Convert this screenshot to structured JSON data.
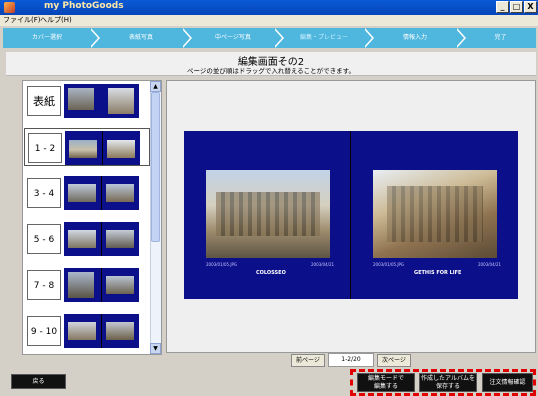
{
  "window": {
    "title": "my  PhotoGoods",
    "controls": [
      "_",
      "□",
      "X"
    ]
  },
  "menu": [
    "ファイル(F)",
    "ヘルプ(H)"
  ],
  "steps": [
    "カバー選択",
    "表紙写真",
    "中ページ写真",
    "編集・プレビュー",
    "情報入力",
    "完了"
  ],
  "active_step": 3,
  "header": {
    "title": "編集画面その2",
    "subtitle": "ページの並び順はドラッグで入れ替えることができます。"
  },
  "thumbnails": [
    {
      "label": "表紙"
    },
    {
      "label": "1 - 2"
    },
    {
      "label": "3 - 4"
    },
    {
      "label": "5 - 6"
    },
    {
      "label": "7 - 8"
    },
    {
      "label": "9 - 10"
    }
  ],
  "selected_index": 1,
  "preview": {
    "left_file": "2003/01/05.JPG",
    "left_date": "2003/04/21",
    "left_caption": "COLOSSEO",
    "right_file": "2003/01/05.JPG",
    "right_date": "2003/04/21",
    "right_caption": "GETHIS FOR LIFE"
  },
  "pager": {
    "prev": "前ページ",
    "value": "1-2/20",
    "next": "次ページ"
  },
  "bottom": {
    "back": "戻る",
    "edit_mode_1": "編集モードで",
    "edit_mode_2": "編集する",
    "save_album_1": "作成したアルバムを",
    "save_album_2": "保存する",
    "confirm_order": "注文情報確認"
  },
  "colors": {
    "titlebar": "#0645b8",
    "stepbar": "#4fb6de",
    "page_background": "#0b0f8a",
    "highlight": "#e00000"
  }
}
